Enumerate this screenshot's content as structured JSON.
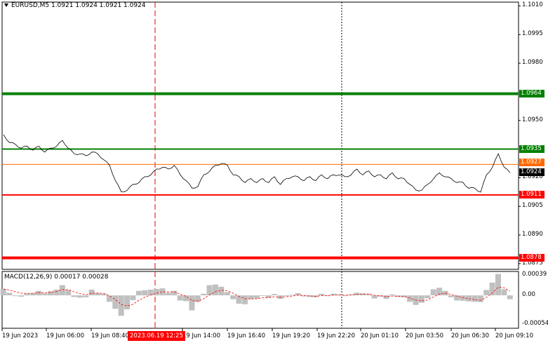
{
  "window": {
    "title": "EURUSD,M5  1.0921 1.0924 1.0921 1.0924"
  },
  "price_axis": {
    "ticks": [
      "1.1010",
      "1.0995",
      "1.0980",
      "1.0950",
      "1.0920",
      "1.0905",
      "1.0890",
      "1.0875"
    ],
    "tick_values": [
      1.101,
      1.0995,
      1.098,
      1.095,
      1.092,
      1.0905,
      1.089,
      1.0875
    ],
    "range": [
      1.0872,
      1.1012
    ]
  },
  "levels": [
    {
      "value": 1.0964,
      "label": "1.0964",
      "color": "#008000"
    },
    {
      "value": 1.0935,
      "label": "1.0935",
      "color": "#008000"
    },
    {
      "value": 1.0927,
      "label": "1.0927",
      "color": "#ff6a00"
    },
    {
      "value": 1.0924,
      "label": "1.0924",
      "color": "#000000"
    },
    {
      "value": 1.0911,
      "label": "1.0911",
      "color": "#ff0000"
    },
    {
      "value": 1.0878,
      "label": "1.0878",
      "color": "#ff0000"
    }
  ],
  "macd": {
    "title": "MACD(12,26,9) 0.00017 0.00028",
    "ticks": [
      "0.00039",
      "0.00",
      "-0.00054"
    ],
    "tick_values": [
      0.00039,
      0.0,
      -0.00054
    ],
    "histogram_color": "#c0c0c0",
    "signal_color": "#ff0000"
  },
  "time_axis": {
    "ticks": [
      "19 Jun 2023",
      "19 Jun 06:00",
      "19 Jun 08:40",
      "19 Jun 14:00",
      "19 Jun 16:40",
      "19 Jun 19:20",
      "19 Jun 22:20",
      "20 Jun 01:10",
      "20 Jun 03:50",
      "20 Jun 06:30",
      "20 Jun 09:10"
    ],
    "cursor_label": "2023.06.19 12:25"
  },
  "chart_data": {
    "type": "line",
    "title": "EURUSD,M5",
    "x_labels": [
      "19 Jun 2023",
      "19 Jun 06:00",
      "19 Jun 08:40",
      "19 Jun 14:00",
      "19 Jun 16:40",
      "19 Jun 19:20",
      "19 Jun 22:20",
      "20 Jun 01:10",
      "20 Jun 03:50",
      "20 Jun 06:30",
      "20 Jun 09:10"
    ],
    "series": [
      {
        "values": [
          1.0942,
          1.0939,
          1.0937,
          1.0936,
          1.0936,
          1.0935,
          1.0936,
          1.0934,
          1.0935,
          1.0937,
          1.0939,
          1.0936,
          1.0932,
          1.0933,
          1.0931,
          1.0934,
          1.0932,
          1.093,
          1.0926,
          1.0919,
          1.0912,
          1.0914,
          1.0916,
          1.0918,
          1.092,
          1.0922,
          1.0924,
          1.0926,
          1.0924,
          1.0927,
          1.0921,
          1.0919,
          1.0914,
          1.0916,
          1.0921,
          1.0924,
          1.0926,
          1.0928,
          1.0926,
          1.0922,
          1.092,
          1.0918,
          1.0919,
          1.0918,
          1.0919,
          1.0918,
          1.092,
          1.0917,
          1.0919,
          1.0921,
          1.092,
          1.0919,
          1.092,
          1.0919,
          1.0921,
          1.092,
          1.0921,
          1.0922,
          1.092,
          1.0922,
          1.0924,
          1.0922,
          1.0923,
          1.0921,
          1.0921,
          1.092,
          1.0922,
          1.092,
          1.0919,
          1.0917,
          1.0913,
          1.0914,
          1.0916,
          1.092,
          1.0922,
          1.0921,
          1.0919,
          1.0918,
          1.0917,
          1.0915,
          1.0914,
          1.0913,
          1.0921,
          1.0926,
          1.0932,
          1.0926,
          1.0922
        ]
      }
    ],
    "ylim": [
      1.0872,
      1.1012
    ]
  }
}
